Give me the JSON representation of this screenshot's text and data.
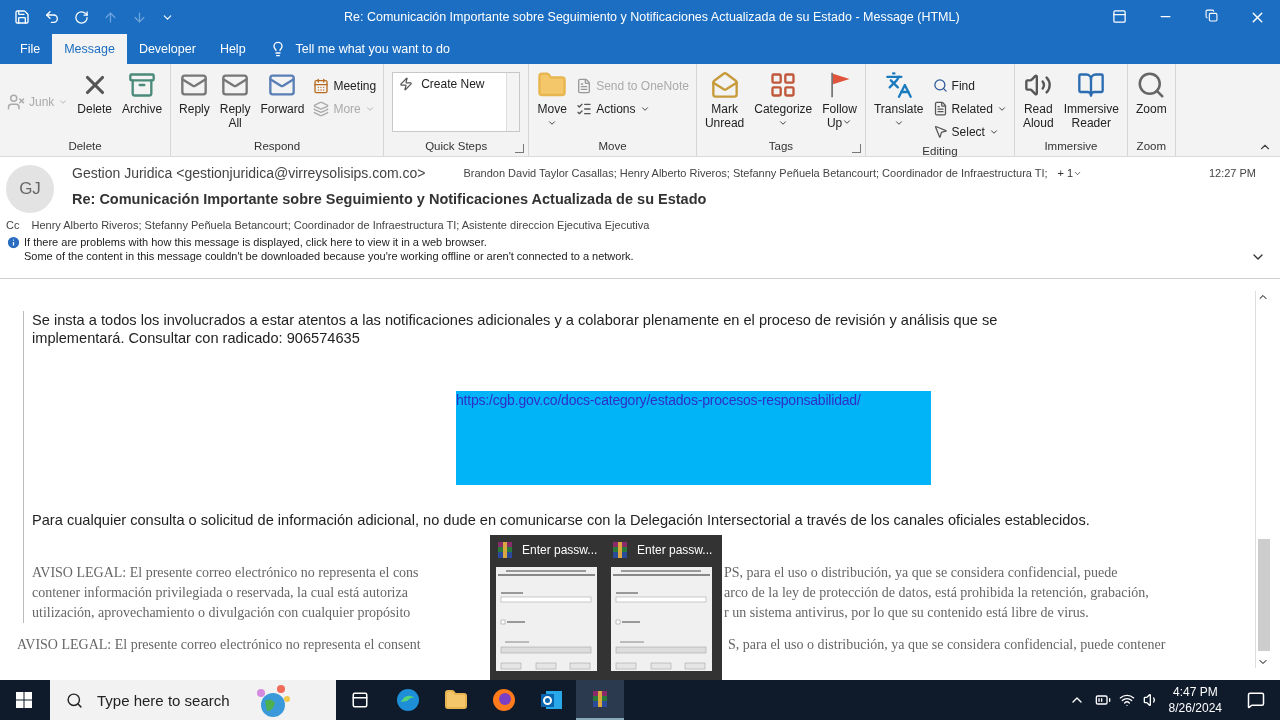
{
  "window": {
    "title": "Re: Comunicación Importante sobre Seguimiento y Notificaciones Actualizada de su Estado  -  Message (HTML)"
  },
  "menu_tabs": [
    {
      "label": "File",
      "selected": false
    },
    {
      "label": "Message",
      "selected": true
    },
    {
      "label": "Developer",
      "selected": false
    },
    {
      "label": "Help",
      "selected": false
    }
  ],
  "tell_me": {
    "placeholder": "Tell me what you want to do"
  },
  "ribbon": [
    {
      "label": "Delete",
      "items": [
        {
          "kind": "small",
          "label": "Junk",
          "disabled": true,
          "dropdown": true
        },
        {
          "kind": "large",
          "label": "Delete"
        },
        {
          "kind": "large",
          "label": "Archive"
        }
      ]
    },
    {
      "label": "Respond",
      "items": [
        {
          "kind": "large",
          "label": "Reply"
        },
        {
          "kind": "large",
          "label": "Reply\nAll"
        },
        {
          "kind": "large",
          "label": "Forward"
        },
        {
          "kind": "stack",
          "children": [
            {
              "label": "Meeting"
            },
            {
              "label": "More",
              "disabled": true,
              "dropdown": true
            }
          ]
        }
      ]
    },
    {
      "label": "Quick Steps",
      "launcher": true,
      "items": [
        {
          "kind": "gallery",
          "label": "Create New"
        }
      ]
    },
    {
      "label": "Move",
      "items": [
        {
          "kind": "large",
          "label": "Move",
          "dropdown": true
        },
        {
          "kind": "stack",
          "children": [
            {
              "label": "Send to OneNote",
              "disabled": true
            },
            {
              "label": "Actions",
              "dropdown": true
            }
          ]
        }
      ]
    },
    {
      "label": "Tags",
      "launcher": true,
      "items": [
        {
          "kind": "large",
          "label": "Mark\nUnread"
        },
        {
          "kind": "large",
          "label": "Categorize",
          "dropdown": true
        },
        {
          "kind": "large",
          "label": "Follow\nUp",
          "dropdown": true
        }
      ]
    },
    {
      "label": "Editing",
      "items": [
        {
          "kind": "large",
          "label": "Translate",
          "dropdown": true
        },
        {
          "kind": "stack",
          "children": [
            {
              "label": "Find"
            },
            {
              "label": "Related",
              "dropdown": true
            },
            {
              "label": "Select",
              "dropdown": true
            }
          ]
        }
      ]
    },
    {
      "label": "Immersive",
      "items": [
        {
          "kind": "large",
          "label": "Read\nAloud"
        },
        {
          "kind": "large",
          "label": "Immersive\nReader"
        }
      ]
    },
    {
      "label": "Zoom",
      "items": [
        {
          "kind": "large",
          "label": "Zoom"
        }
      ]
    }
  ],
  "header": {
    "initials": "GJ",
    "from": "Gestion Juridica <gestionjuridica@virreysolisips.com.co>",
    "to": "Brandon David Taylor Casallas; Henry Alberto Riveros; Stefanny Peñuela Betancourt; Coordinador de Infraestructura TI;",
    "more": "+ 1",
    "time": "12:27 PM",
    "subject": "Re: Comunicación Importante sobre Seguimiento y Notificaciones Actualizada de su Estado",
    "cc_label": "Cc",
    "cc": "Henry Alberto Riveros; Stefanny Peñuela Betancourt; Coordinador de Infraestructura TI; Asistente direccion Ejecutiva Ejecutiva",
    "info": [
      "If there are problems with how this message is displayed, click here to view it in a web browser.",
      "Some of the content in this message couldn't be downloaded because you're working offline or aren't connected to a network."
    ]
  },
  "body": {
    "paragraph_1": "Se insta a todos los involucrados a estar atentos a las notificaciones adicionales y a colaborar plenamente en el proceso de revisión y análisis que se\nimplementará. Consultar con radicado: 906574635",
    "link": "https:/cgb.gov.co/docs-category/estados-procesos-responsabilidad/",
    "paragraph_2": "Para cualquier consulta o solicitud de información adicional, no dude en comunicarse con la Delegación Intersectorial a través de los canales oficiales establecidos.",
    "legal_quoted": [
      [
        "AVISO LEGAL: El presente correo electrónico no representa el cons",
        "PS, para el uso o distribución, ya que se considera confidencial, puede"
      ],
      [
        "contener información privilegiada o reservada, la cual está autoriza",
        "arco de la ley de protección de datos, está prohibida la retención, grabación,"
      ],
      [
        "utilización, aprovechamiento o divulgación con cualquier propósito",
        "r un sistema antivirus, por lo que su contenido está libre de virus."
      ]
    ],
    "legal": [
      "AVISO LEGAL: El presente correo electrónico no representa el consent",
      "S, para el uso o distribución, ya que se considera confidencial, puede contener"
    ]
  },
  "thumbnails": [
    {
      "title": "Enter passw..."
    },
    {
      "title": "Enter passw..."
    }
  ],
  "taskbar": {
    "search": {
      "placeholder": "Type here to search"
    },
    "time": "4:47 PM",
    "date": "8/26/2024"
  }
}
